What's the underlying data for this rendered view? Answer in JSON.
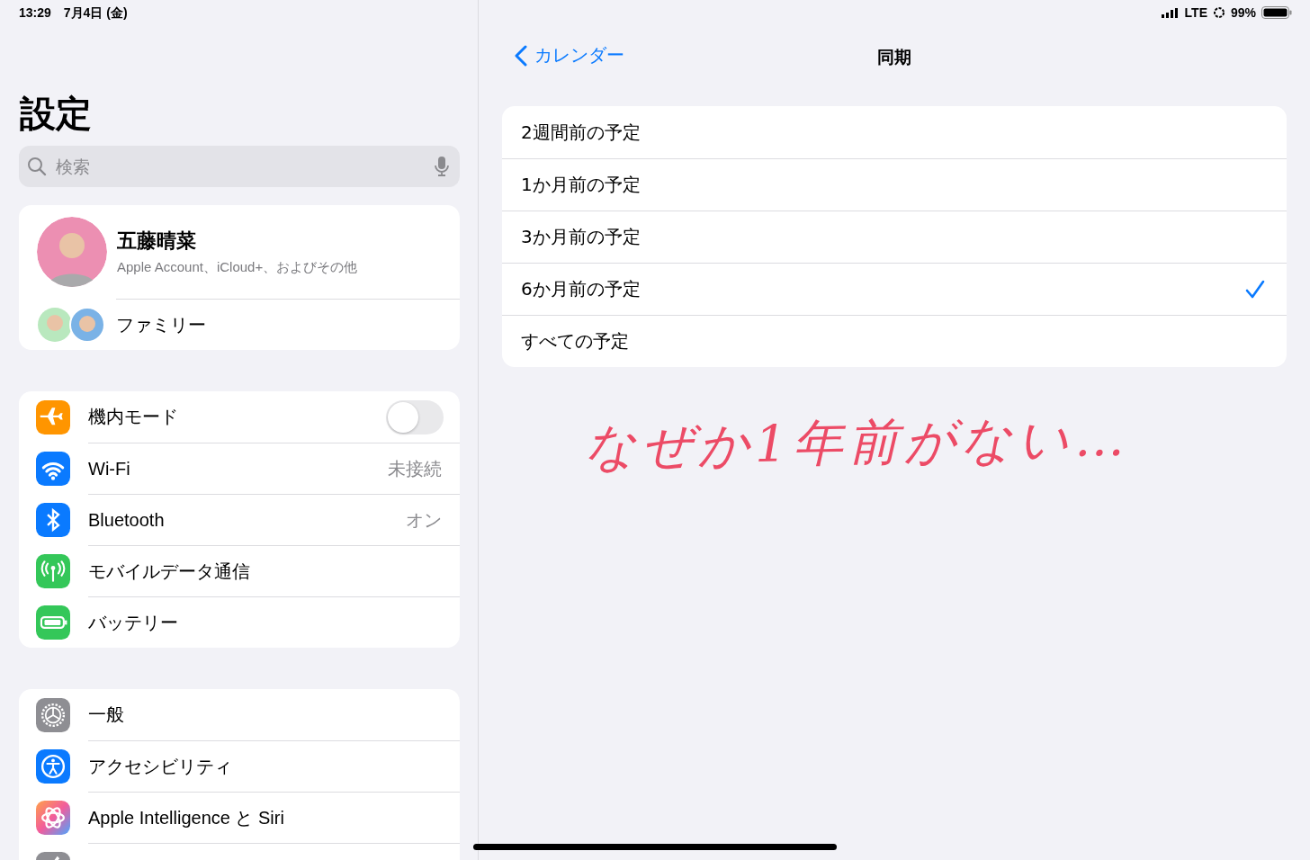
{
  "status_bar": {
    "time": "13:29",
    "date": "7月4日 (金)",
    "network": "LTE",
    "battery": "99%"
  },
  "sidebar": {
    "title": "設定",
    "search": {
      "placeholder": "検索"
    },
    "account": {
      "name": "五藤晴菜",
      "subtitle": "Apple Account、iCloud+、およびその他"
    },
    "family": {
      "label": "ファミリー"
    },
    "groups": [
      {
        "items": [
          {
            "kind": "toggle",
            "label": "機内モード",
            "on": false
          },
          {
            "kind": "value",
            "label": "Wi-Fi",
            "value": "未接続"
          },
          {
            "kind": "value",
            "label": "Bluetooth",
            "value": "オン"
          },
          {
            "kind": "plain",
            "label": "モバイルデータ通信"
          },
          {
            "kind": "plain",
            "label": "バッテリー"
          }
        ]
      },
      {
        "items": [
          {
            "kind": "plain",
            "label": "一般"
          },
          {
            "kind": "plain",
            "label": "アクセシビリティ"
          },
          {
            "kind": "plain",
            "label": "Apple Intelligence と Siri"
          },
          {
            "kind": "partial"
          }
        ]
      }
    ]
  },
  "detail": {
    "nav": {
      "back": "カレンダー",
      "title": "同期"
    },
    "options": [
      {
        "label": "2週間前の予定",
        "selected": false
      },
      {
        "label": "1か月前の予定",
        "selected": false
      },
      {
        "label": "3か月前の予定",
        "selected": false
      },
      {
        "label": "6か月前の予定",
        "selected": true
      },
      {
        "label": "すべての予定",
        "selected": false
      }
    ],
    "annotation": {
      "text": "なぜか1年前がない…"
    }
  }
}
